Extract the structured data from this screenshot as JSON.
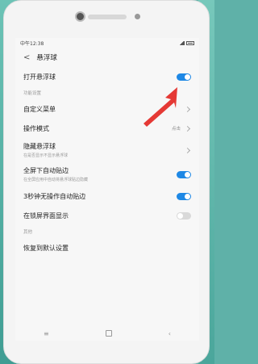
{
  "status": {
    "time": "中午12:38"
  },
  "title": "悬浮球",
  "main_toggle": {
    "label": "打开悬浮球",
    "on": true
  },
  "section_function": "功能设置",
  "items": {
    "custom_menu": "自定义菜单",
    "mode": {
      "label": "操作模式",
      "value": "点击"
    },
    "hide": {
      "label": "隐藏悬浮球",
      "sub": "在是否显示不显示悬浮球"
    },
    "fullscreen": {
      "label": "全屏下自动贴边",
      "sub": "在全屏应用中自动将悬浮球贴边隐藏",
      "on": true
    },
    "idle": {
      "label": "3秒钟无操作自动贴边",
      "on": true
    },
    "lockscreen": {
      "label": "在锁屏界面显示",
      "on": false
    }
  },
  "section_other": "其他",
  "reset": "恢复到默认设置",
  "icons": [
    "back-icon",
    "chevron-right-icon",
    "menu-icon",
    "home-icon",
    "back-nav-icon",
    "red-arrow-icon"
  ],
  "colors": {
    "toggle_on": "#1e88e5",
    "arrow": "#e53935"
  }
}
